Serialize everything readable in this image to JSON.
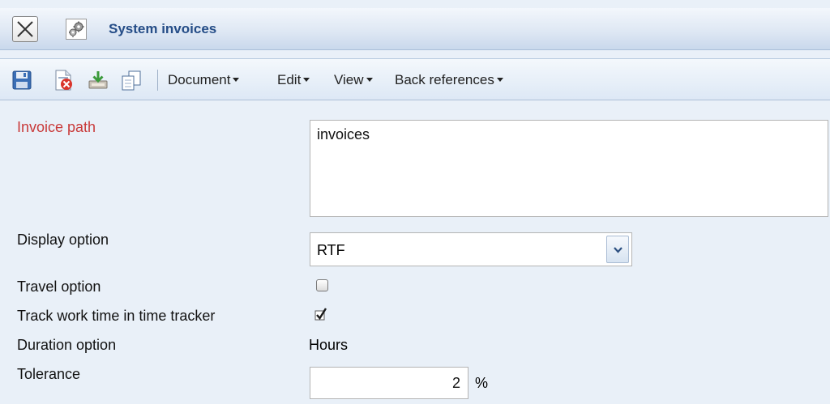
{
  "window": {
    "title": "System invoices",
    "close_icon": "close-icon",
    "app_icon": "gears-icon"
  },
  "toolbar": {
    "icons": [
      "save-icon",
      "delete-icon",
      "import-icon",
      "copy-icon"
    ],
    "menus": [
      "Document",
      "Edit",
      "View",
      "Back references"
    ]
  },
  "form": {
    "invoice_path": {
      "label": "Invoice path",
      "value": "invoices",
      "required": true
    },
    "display_option": {
      "label": "Display option",
      "selected": "RTF"
    },
    "travel_option": {
      "label": "Travel option",
      "checked": false
    },
    "track_work_time": {
      "label": "Track work time in time tracker",
      "checked": true
    },
    "duration_option": {
      "label": "Duration option",
      "value": "Hours"
    },
    "tolerance": {
      "label": "Tolerance",
      "value": "2",
      "unit": "%"
    }
  },
  "colors": {
    "title_text": "#254d87",
    "required_label": "#c93a3a",
    "background": "#e9f0f8"
  }
}
